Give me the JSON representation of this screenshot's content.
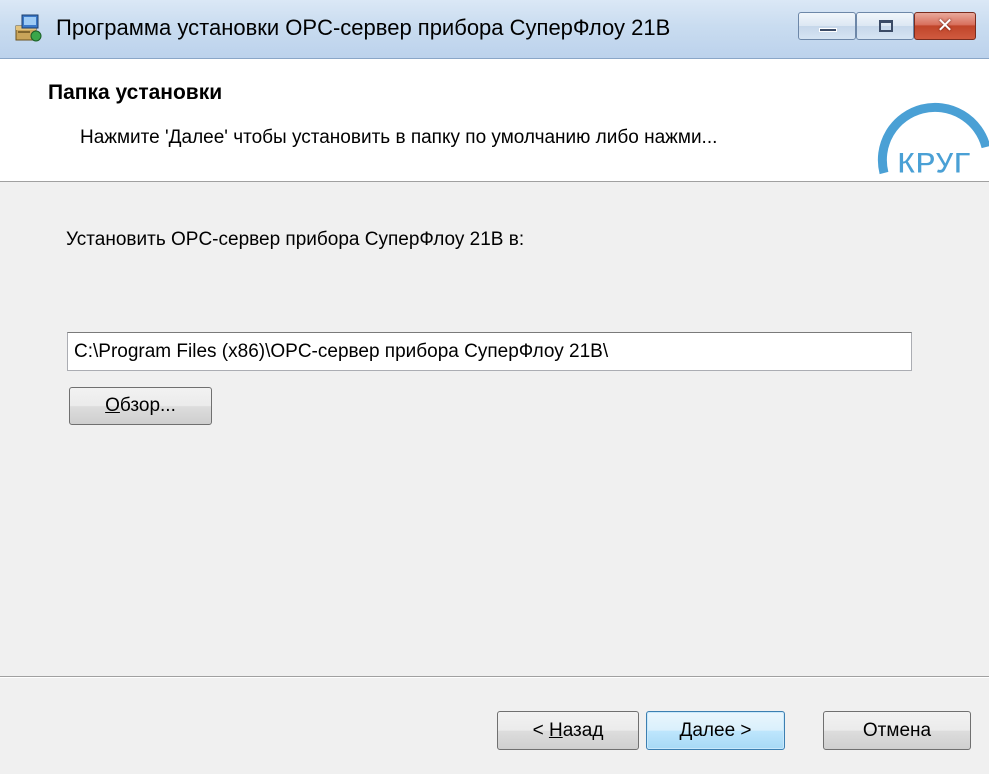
{
  "window": {
    "title": "Программа установки OPC-сервер прибора СуперФлоу 21В",
    "min_icon": "minimize-icon",
    "max_icon": "maximize-icon",
    "close_icon": "close-icon",
    "close_glyph": "✕"
  },
  "banner": {
    "title": "Папка установки",
    "description": "Нажмите 'Далее' чтобы установить в папку по умолчанию либо нажми...",
    "logo_text": "КРУГ",
    "logo_color": "#4aa0d5"
  },
  "main": {
    "install_label": "Установить OPC-сервер прибора СуперФлоу 21В в:",
    "install_path": "C:\\Program Files (x86)\\OPC-сервер прибора СуперФлоу 21В\\",
    "browse_mnemonic": "О",
    "browse_rest": "бзор..."
  },
  "footer": {
    "back_prefix": "< ",
    "back_mnemonic": "Н",
    "back_rest": "азад",
    "next_label": "Далее >",
    "cancel_label": "Отмена"
  },
  "colors": {
    "accent": "#3c7fb1",
    "close_red": "#c0452a",
    "titlebar": "#c9dcf0"
  }
}
